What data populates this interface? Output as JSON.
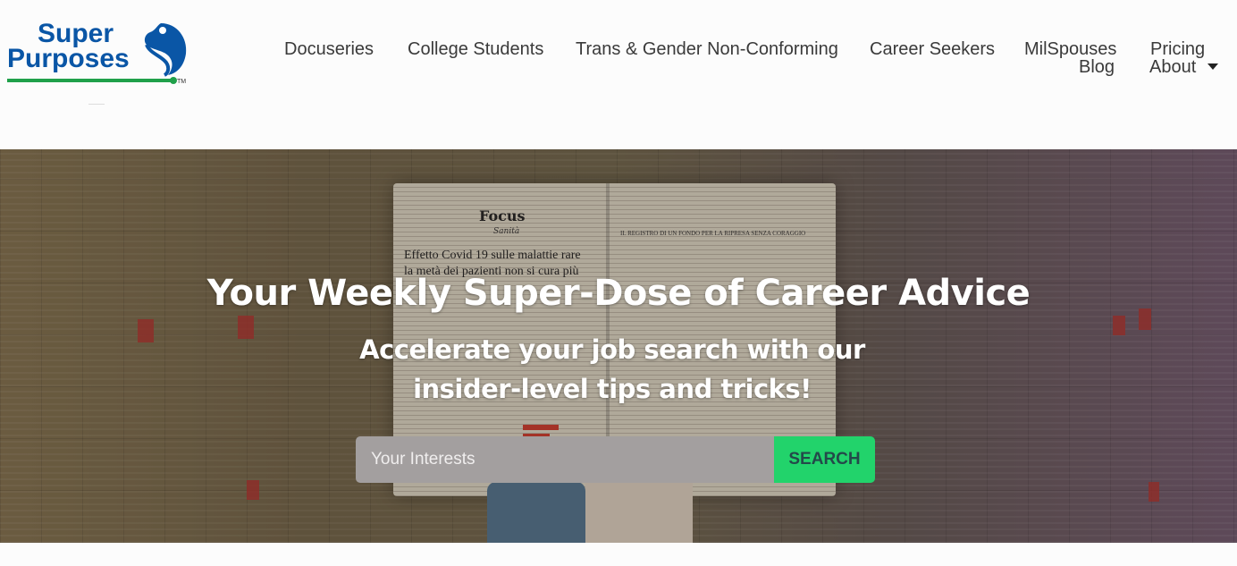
{
  "brand": {
    "line1": "Super",
    "line2": "Purposes",
    "trademark": "TM",
    "color_blue": "#0a56a6",
    "color_green": "#20a04a"
  },
  "nav": {
    "items": [
      "Docuseries",
      "College Students",
      "Trans & Gender Non-Conforming",
      "Career Seekers",
      "MilSpouses",
      "Pricing",
      "Blog",
      "About"
    ],
    "about_dropdown_icon": "caret-down-icon"
  },
  "hero": {
    "title": "Your Weekly Super-Dose of Career Advice",
    "subtitle": "Accelerate your job search with our insider-level tips and tricks!",
    "newspaper": {
      "masthead": "Focus",
      "section": "Sanità",
      "headline": "Effetto Covid 19 sulle malattie rare la metà dei pazienti non si cura più",
      "right_headline": "IL REGISTRO DI UN FONDO PER LA RIPRESA SENZA CORAGGIO"
    }
  },
  "search": {
    "placeholder": "Your Interests",
    "button_label": "SEARCH",
    "button_color": "#22d36b"
  }
}
